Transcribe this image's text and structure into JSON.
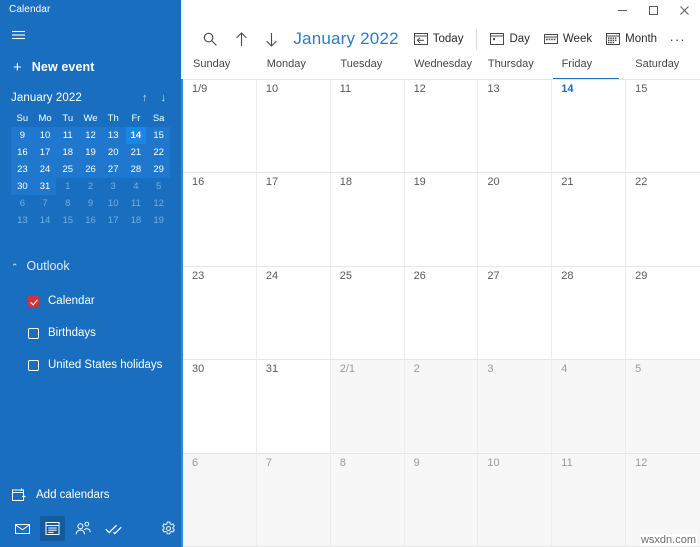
{
  "window": {
    "app_title": "Calendar",
    "controls": {
      "minimize": "minimize-button",
      "maximize": "maximize-button",
      "close": "close-button"
    }
  },
  "sidebar": {
    "menu_icon": "hamburger-icon",
    "new_event": {
      "plus": "+",
      "label": "New event"
    },
    "mini_calendar": {
      "title": "January 2022",
      "prev_label": "↑",
      "next_label": "↓",
      "day_initials": [
        "Su",
        "Mo",
        "Tu",
        "We",
        "Th",
        "Fr",
        "Sa"
      ],
      "weeks": [
        [
          {
            "n": "9",
            "muted": false,
            "sel": true,
            "today": false
          },
          {
            "n": "10",
            "muted": false,
            "sel": true,
            "today": false
          },
          {
            "n": "11",
            "muted": false,
            "sel": true,
            "today": false
          },
          {
            "n": "12",
            "muted": false,
            "sel": true,
            "today": false
          },
          {
            "n": "13",
            "muted": false,
            "sel": true,
            "today": false
          },
          {
            "n": "14",
            "muted": false,
            "sel": true,
            "today": true
          },
          {
            "n": "15",
            "muted": false,
            "sel": true,
            "today": false
          }
        ],
        [
          {
            "n": "16",
            "muted": false,
            "sel": true,
            "today": false
          },
          {
            "n": "17",
            "muted": false,
            "sel": true,
            "today": false
          },
          {
            "n": "18",
            "muted": false,
            "sel": true,
            "today": false
          },
          {
            "n": "19",
            "muted": false,
            "sel": true,
            "today": false
          },
          {
            "n": "20",
            "muted": false,
            "sel": true,
            "today": false
          },
          {
            "n": "21",
            "muted": false,
            "sel": true,
            "today": false
          },
          {
            "n": "22",
            "muted": false,
            "sel": true,
            "today": false
          }
        ],
        [
          {
            "n": "23",
            "muted": false,
            "sel": true,
            "today": false
          },
          {
            "n": "24",
            "muted": false,
            "sel": true,
            "today": false
          },
          {
            "n": "25",
            "muted": false,
            "sel": true,
            "today": false
          },
          {
            "n": "26",
            "muted": false,
            "sel": true,
            "today": false
          },
          {
            "n": "27",
            "muted": false,
            "sel": true,
            "today": false
          },
          {
            "n": "28",
            "muted": false,
            "sel": true,
            "today": false
          },
          {
            "n": "29",
            "muted": false,
            "sel": true,
            "today": false
          }
        ],
        [
          {
            "n": "30",
            "muted": false,
            "sel": true,
            "today": false
          },
          {
            "n": "31",
            "muted": false,
            "sel": true,
            "today": false
          },
          {
            "n": "1",
            "muted": true,
            "sel": false,
            "today": false
          },
          {
            "n": "2",
            "muted": true,
            "sel": false,
            "today": false
          },
          {
            "n": "3",
            "muted": true,
            "sel": false,
            "today": false
          },
          {
            "n": "4",
            "muted": true,
            "sel": false,
            "today": false
          },
          {
            "n": "5",
            "muted": true,
            "sel": false,
            "today": false
          }
        ],
        [
          {
            "n": "6",
            "muted": true,
            "sel": false,
            "today": false
          },
          {
            "n": "7",
            "muted": true,
            "sel": false,
            "today": false
          },
          {
            "n": "8",
            "muted": true,
            "sel": false,
            "today": false
          },
          {
            "n": "9",
            "muted": true,
            "sel": false,
            "today": false
          },
          {
            "n": "10",
            "muted": true,
            "sel": false,
            "today": false
          },
          {
            "n": "11",
            "muted": true,
            "sel": false,
            "today": false
          },
          {
            "n": "12",
            "muted": true,
            "sel": false,
            "today": false
          }
        ],
        [
          {
            "n": "13",
            "muted": true,
            "sel": false,
            "today": false
          },
          {
            "n": "14",
            "muted": true,
            "sel": false,
            "today": false
          },
          {
            "n": "15",
            "muted": true,
            "sel": false,
            "today": false
          },
          {
            "n": "16",
            "muted": true,
            "sel": false,
            "today": false
          },
          {
            "n": "17",
            "muted": true,
            "sel": false,
            "today": false
          },
          {
            "n": "18",
            "muted": true,
            "sel": false,
            "today": false
          },
          {
            "n": "19",
            "muted": true,
            "sel": false,
            "today": false
          }
        ]
      ]
    },
    "account": {
      "chevron": "⌃",
      "name": "Outlook",
      "calendars": [
        {
          "label": "Calendar",
          "checked": true
        },
        {
          "label": "Birthdays",
          "checked": false
        },
        {
          "label": "United States holidays",
          "checked": false
        }
      ]
    },
    "add_calendars": {
      "icon": "add-calendar-icon",
      "label": "Add calendars"
    },
    "bottom_nav": [
      {
        "name": "mail",
        "active": false
      },
      {
        "name": "calendar",
        "active": true
      },
      {
        "name": "people",
        "active": false
      },
      {
        "name": "todo",
        "active": false
      },
      {
        "name": "settings",
        "active": false
      }
    ]
  },
  "toolbar": {
    "search_icon": "search-icon",
    "prev_label": "↑",
    "next_label": "↓",
    "month_title": "January 2022",
    "today_label": "Today",
    "day_label": "Day",
    "week_label": "Week",
    "month_label": "Month",
    "more_label": "···"
  },
  "calendar": {
    "day_headers": [
      "Sunday",
      "Monday",
      "Tuesday",
      "Wednesday",
      "Thursday",
      "Friday",
      "Saturday"
    ],
    "today_column_index": 5,
    "weeks": [
      [
        {
          "n": "1/9",
          "other": false,
          "today": false
        },
        {
          "n": "10",
          "other": false,
          "today": false
        },
        {
          "n": "11",
          "other": false,
          "today": false
        },
        {
          "n": "12",
          "other": false,
          "today": false
        },
        {
          "n": "13",
          "other": false,
          "today": false
        },
        {
          "n": "14",
          "other": false,
          "today": true
        },
        {
          "n": "15",
          "other": false,
          "today": false
        }
      ],
      [
        {
          "n": "16",
          "other": false,
          "today": false
        },
        {
          "n": "17",
          "other": false,
          "today": false
        },
        {
          "n": "18",
          "other": false,
          "today": false
        },
        {
          "n": "19",
          "other": false,
          "today": false
        },
        {
          "n": "20",
          "other": false,
          "today": false
        },
        {
          "n": "21",
          "other": false,
          "today": false
        },
        {
          "n": "22",
          "other": false,
          "today": false
        }
      ],
      [
        {
          "n": "23",
          "other": false,
          "today": false
        },
        {
          "n": "24",
          "other": false,
          "today": false
        },
        {
          "n": "25",
          "other": false,
          "today": false
        },
        {
          "n": "26",
          "other": false,
          "today": false
        },
        {
          "n": "27",
          "other": false,
          "today": false
        },
        {
          "n": "28",
          "other": false,
          "today": false
        },
        {
          "n": "29",
          "other": false,
          "today": false
        }
      ],
      [
        {
          "n": "30",
          "other": false,
          "today": false
        },
        {
          "n": "31",
          "other": false,
          "today": false
        },
        {
          "n": "2/1",
          "other": true,
          "today": false
        },
        {
          "n": "2",
          "other": true,
          "today": false
        },
        {
          "n": "3",
          "other": true,
          "today": false
        },
        {
          "n": "4",
          "other": true,
          "today": false
        },
        {
          "n": "5",
          "other": true,
          "today": false
        }
      ],
      [
        {
          "n": "6",
          "other": true,
          "today": false
        },
        {
          "n": "7",
          "other": true,
          "today": false
        },
        {
          "n": "8",
          "other": true,
          "today": false
        },
        {
          "n": "9",
          "other": true,
          "today": false
        },
        {
          "n": "10",
          "other": true,
          "today": false
        },
        {
          "n": "11",
          "other": true,
          "today": false
        },
        {
          "n": "12",
          "other": true,
          "today": false
        }
      ]
    ]
  },
  "watermark": "wsxdn.com",
  "colors": {
    "sidebar_blue": "#1a6ec0",
    "accent_blue": "#2e7cc4",
    "today_blue": "#1a87e6",
    "checkbox_red": "#d13438",
    "out_of_month": "#f7f7f7"
  }
}
